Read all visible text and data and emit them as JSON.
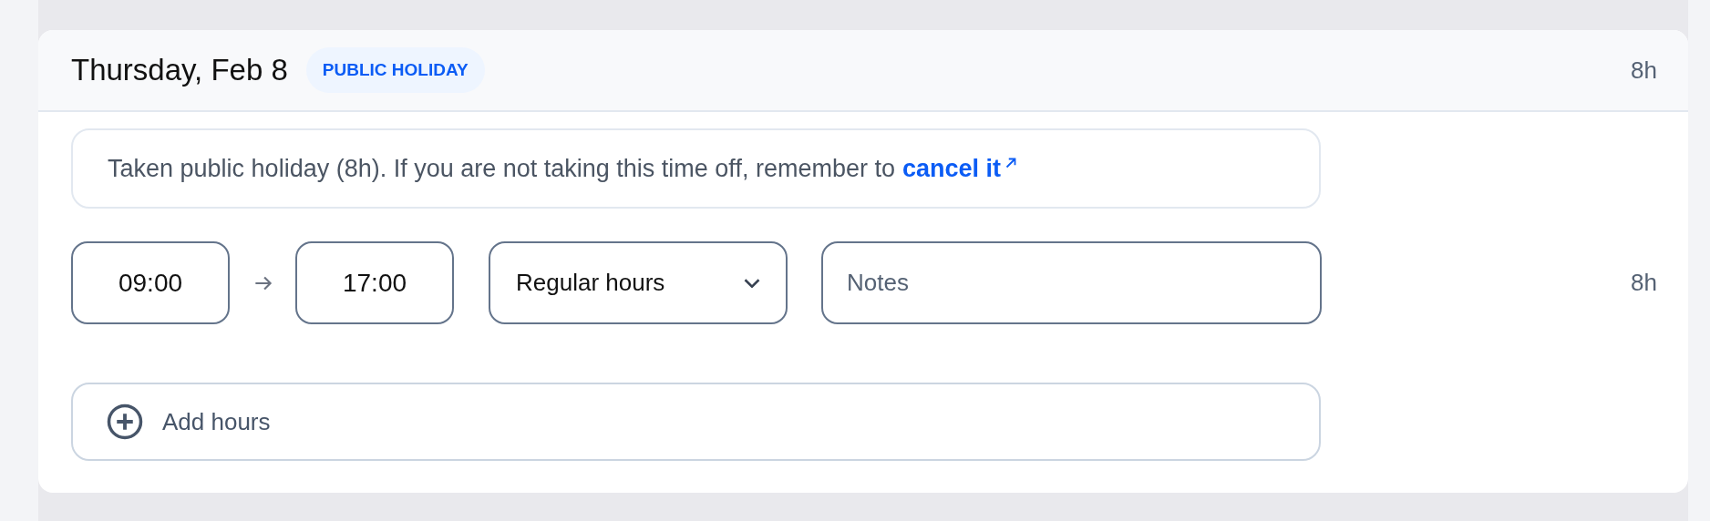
{
  "day": {
    "title": "Thursday, Feb 8",
    "badge": "PUBLIC HOLIDAY",
    "total": "8h"
  },
  "notice": {
    "text": "Taken public holiday (8h). If you are not taking this time off, remember to",
    "link": "cancel it"
  },
  "entries": [
    {
      "start": "09:00",
      "end": "17:00",
      "type": "Regular hours",
      "notes_placeholder": "Notes",
      "total": "8h"
    }
  ],
  "add_button": "Add hours"
}
